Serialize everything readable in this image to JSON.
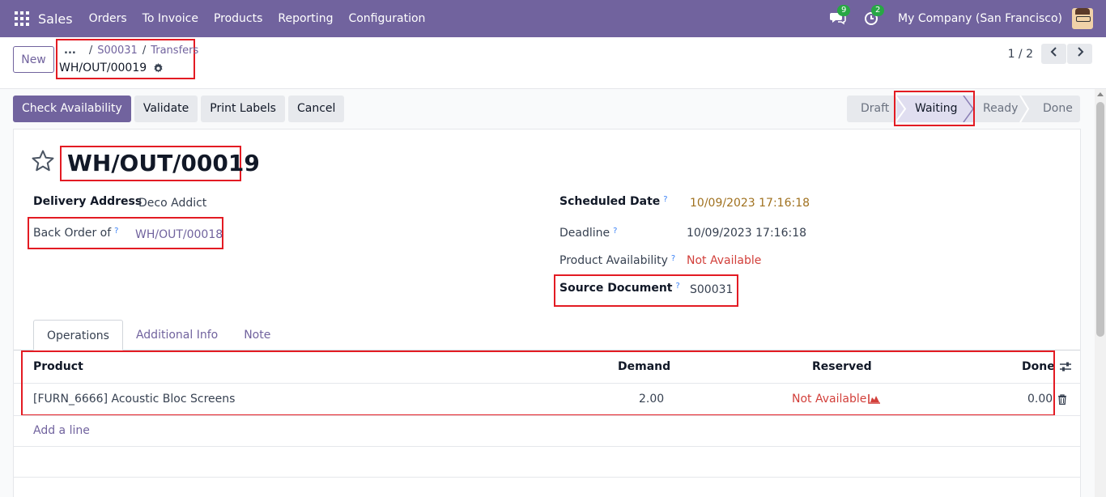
{
  "navbar": {
    "brand": "Sales",
    "menu": [
      "Orders",
      "To Invoice",
      "Products",
      "Reporting",
      "Configuration"
    ],
    "messages_count": "9",
    "activities_count": "2",
    "company": "My Company (San Francisco)"
  },
  "control": {
    "new_label": "New",
    "breadcrumb_dots": "...",
    "breadcrumb_sep": "/",
    "breadcrumb": [
      "S00031",
      "Transfers"
    ],
    "record": "WH/OUT/00019",
    "pager": "1 / 2"
  },
  "actions": {
    "check_availability": "Check Availability",
    "validate": "Validate",
    "print_labels": "Print Labels",
    "cancel": "Cancel"
  },
  "status": {
    "stages": [
      "Draft",
      "Waiting",
      "Ready",
      "Done"
    ],
    "current": "Waiting"
  },
  "form": {
    "title": "WH/OUT/00019",
    "delivery_address_label": "Delivery Address",
    "delivery_address": "Deco Addict",
    "back_order_label": "Back Order of",
    "back_order": "WH/OUT/00018",
    "scheduled_date_label": "Scheduled Date",
    "scheduled_date": "10/09/2023 17:16:18",
    "deadline_label": "Deadline",
    "deadline": "10/09/2023 17:16:18",
    "availability_label": "Product Availability",
    "availability": "Not Available",
    "source_document_label": "Source Document",
    "source_document": "S00031",
    "help_mark": "?"
  },
  "tabs": [
    "Operations",
    "Additional Info",
    "Note"
  ],
  "table": {
    "headers": {
      "product": "Product",
      "demand": "Demand",
      "reserved": "Reserved",
      "done": "Done"
    },
    "rows": [
      {
        "product": "[FURN_6666] Acoustic Bloc Screens",
        "demand": "2.00",
        "reserved": "Not Available",
        "done": "0.00"
      }
    ],
    "add_line": "Add a line"
  },
  "colors": {
    "accent": "#71639e",
    "highlight": "#e31b23",
    "danger": "#d23f3a"
  }
}
